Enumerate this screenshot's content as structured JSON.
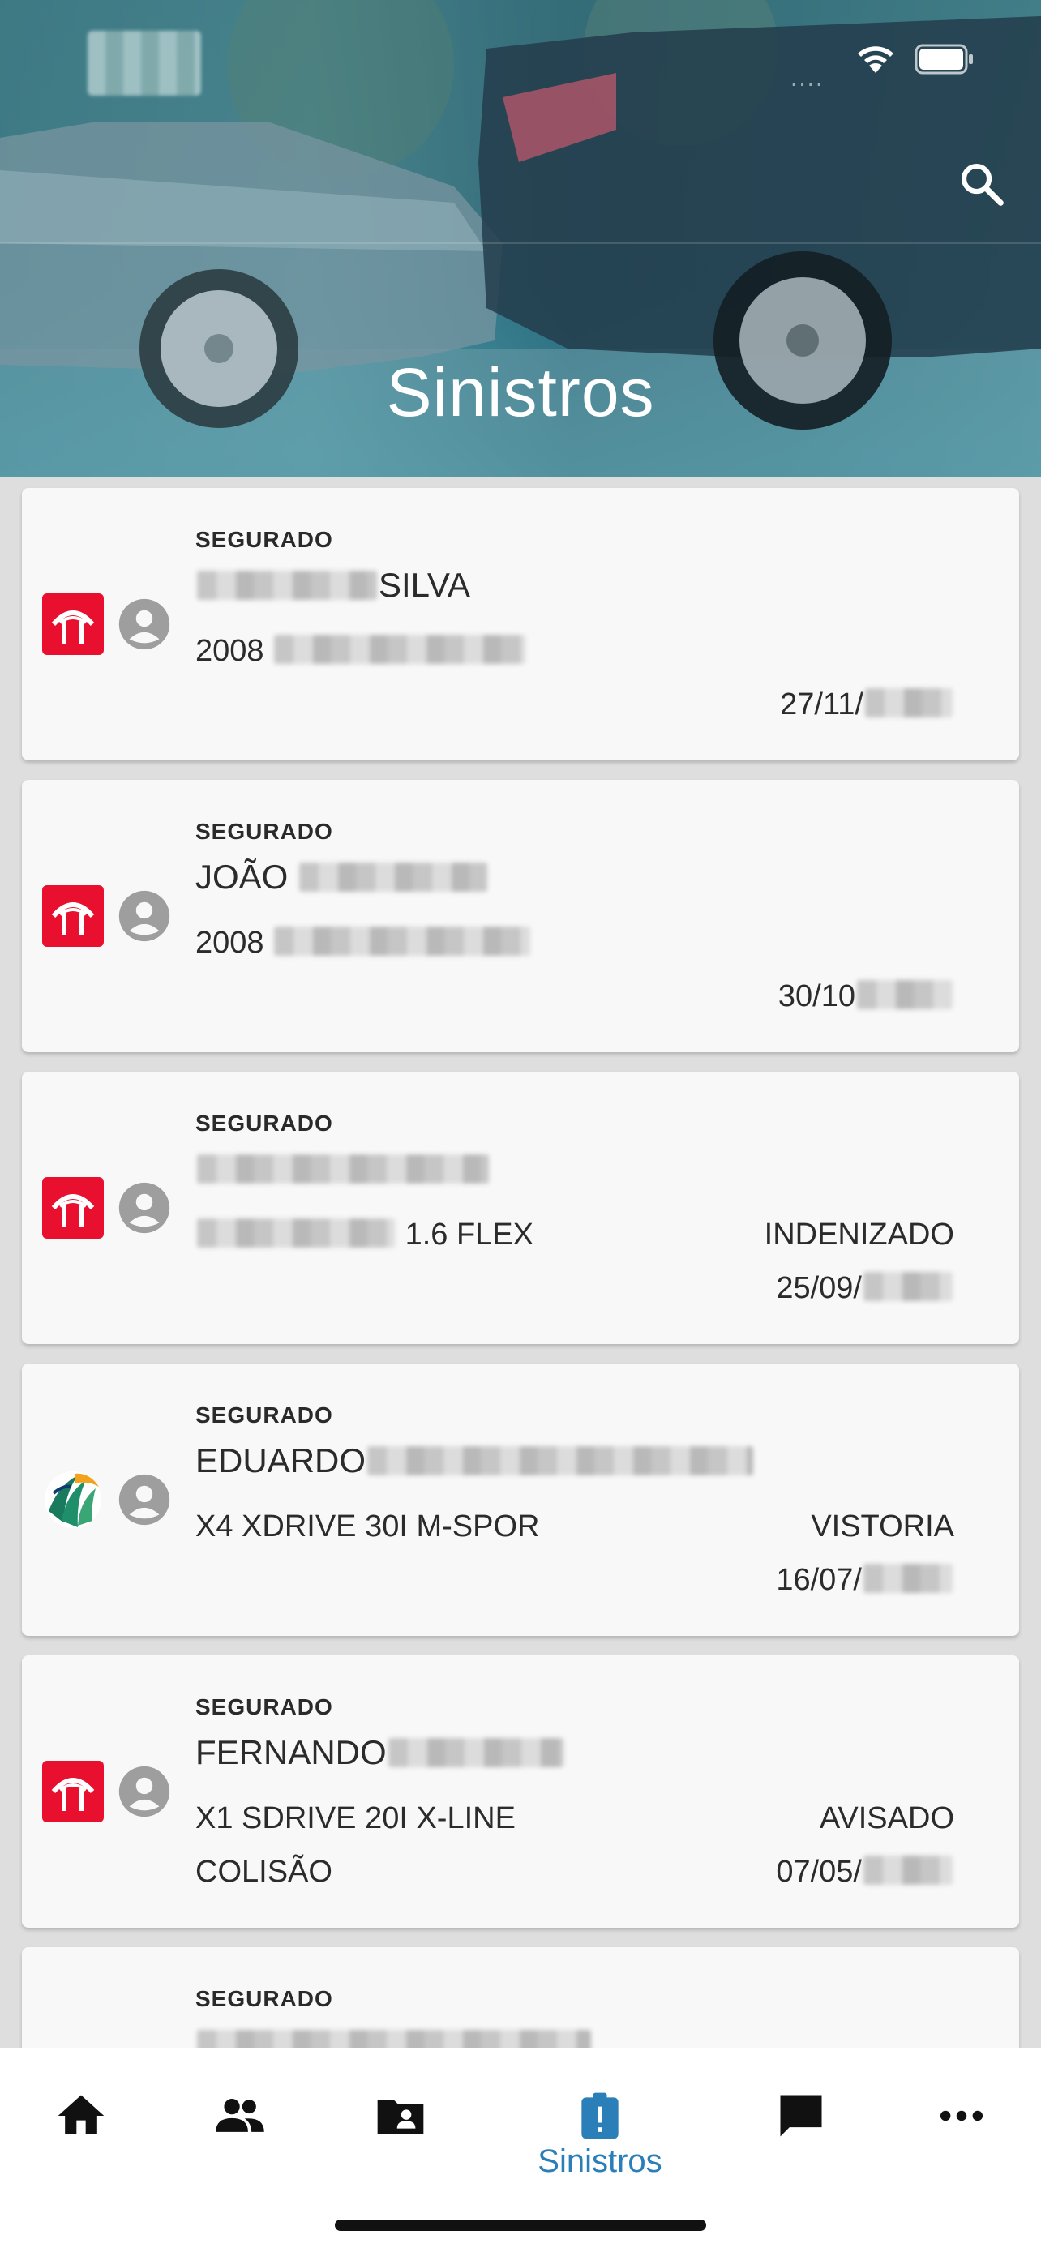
{
  "header": {
    "title": "Sinistros",
    "signal_dots": "....",
    "search_icon": "search-icon",
    "accent_color": "#2a7fb8"
  },
  "claims": [
    {
      "label": "SEGURADO",
      "name_visible": "SILVA",
      "name_visible_position": "end",
      "vehicle_prefix": "2008",
      "vehicle_suffix": "",
      "status": "",
      "extra": "",
      "date_prefix": "27/11/",
      "insurer_logo": "bradesco-logo"
    },
    {
      "label": "SEGURADO",
      "name_visible": "JOÃO",
      "name_visible_position": "start",
      "vehicle_prefix": "2008",
      "vehicle_suffix": "",
      "status": "",
      "extra": "",
      "date_prefix": "30/10",
      "insurer_logo": "bradesco-logo"
    },
    {
      "label": "SEGURADO",
      "name_visible": "",
      "name_visible_position": "start",
      "vehicle_prefix": "",
      "vehicle_suffix": "1.6 FLEX",
      "status": "INDENIZADO",
      "extra": "",
      "date_prefix": "25/09/",
      "insurer_logo": "bradesco-logo"
    },
    {
      "label": "SEGURADO",
      "name_visible": "EDUARDO",
      "name_visible_position": "start",
      "vehicle_prefix": "X4 XDRIVE 30I M-SPOR",
      "vehicle_suffix": "",
      "status": "VISTORIA",
      "extra": "",
      "date_prefix": "16/07/",
      "insurer_logo": "sulamerica-logo"
    },
    {
      "label": "SEGURADO",
      "name_visible": "FERNANDO",
      "name_visible_position": "start",
      "vehicle_prefix": "X1 SDRIVE 20I X-LINE",
      "vehicle_suffix": "",
      "status": "AVISADO",
      "extra": "COLISÃO",
      "date_prefix": "07/05/",
      "insurer_logo": "bradesco-logo"
    },
    {
      "label": "SEGURADO",
      "name_visible": "",
      "name_visible_position": "start",
      "vehicle_prefix": "",
      "vehicle_suffix": "",
      "status": "",
      "extra": "",
      "date_prefix": "",
      "insurer_logo": "bradesco-logo"
    }
  ],
  "nav": {
    "items": [
      {
        "icon": "home-icon"
      },
      {
        "icon": "people-icon"
      },
      {
        "icon": "contact-folder-icon"
      },
      {
        "icon": "clipboard-alert-icon",
        "label": "Sinistros",
        "active": true
      },
      {
        "icon": "chat-icon"
      },
      {
        "icon": "more-icon"
      }
    ],
    "active_label": "Sinistros"
  }
}
